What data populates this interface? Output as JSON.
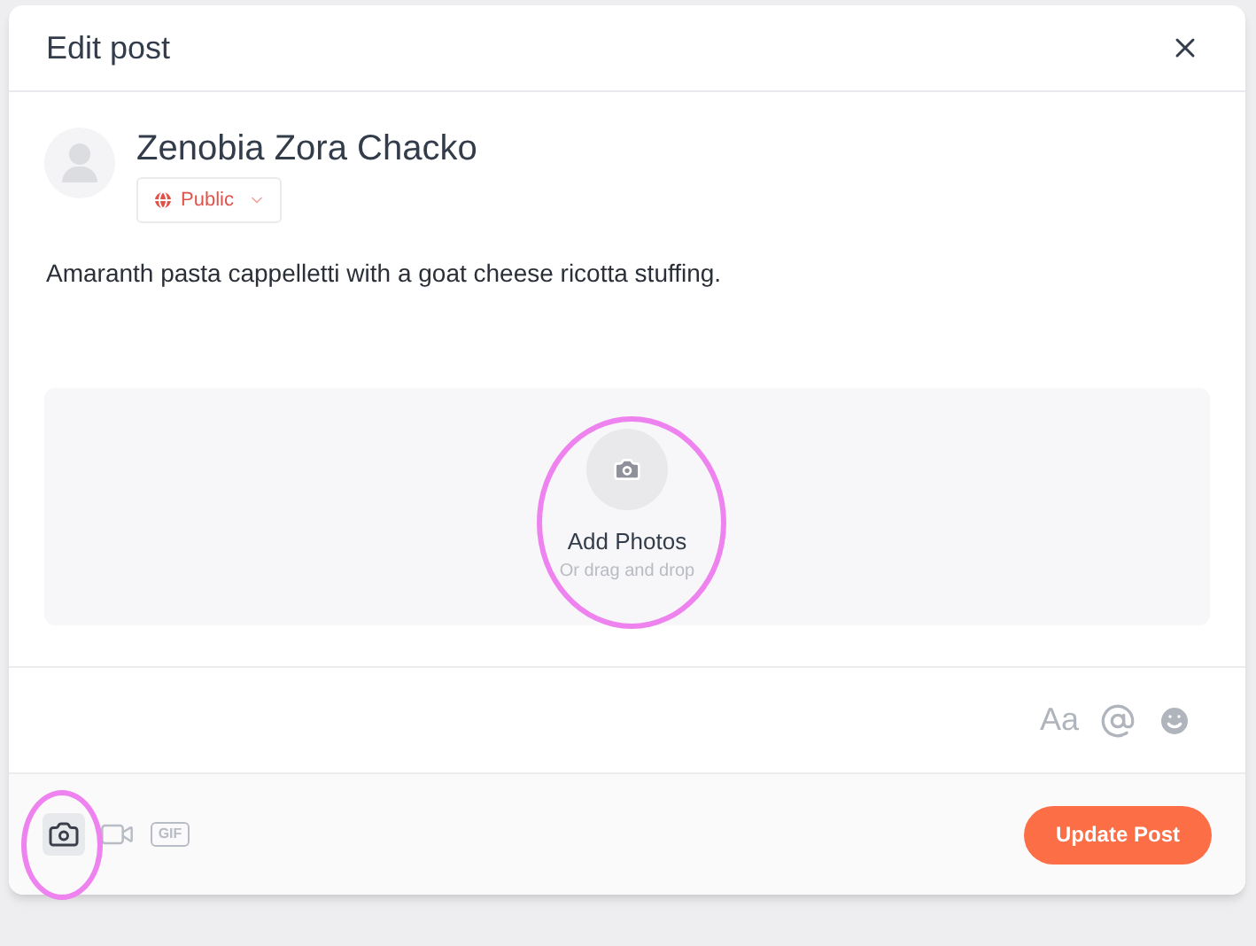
{
  "dialog": {
    "title": "Edit post"
  },
  "author": {
    "name": "Zenobia Zora Chacko",
    "audience": "Public"
  },
  "post": {
    "text": "Amaranth pasta cappelletti with a goat cheese ricotta stuffing."
  },
  "upload": {
    "title": "Add Photos",
    "hint": "Or drag and drop"
  },
  "text_tools": [
    {
      "kind": "text",
      "label": "Aa"
    },
    {
      "kind": "mention"
    },
    {
      "kind": "emoji"
    }
  ],
  "attachments": [
    {
      "kind": "photo",
      "selected": true
    },
    {
      "kind": "video",
      "selected": false
    },
    {
      "kind": "gif",
      "label": "GIF",
      "selected": false
    }
  ],
  "submit": "Update Post"
}
